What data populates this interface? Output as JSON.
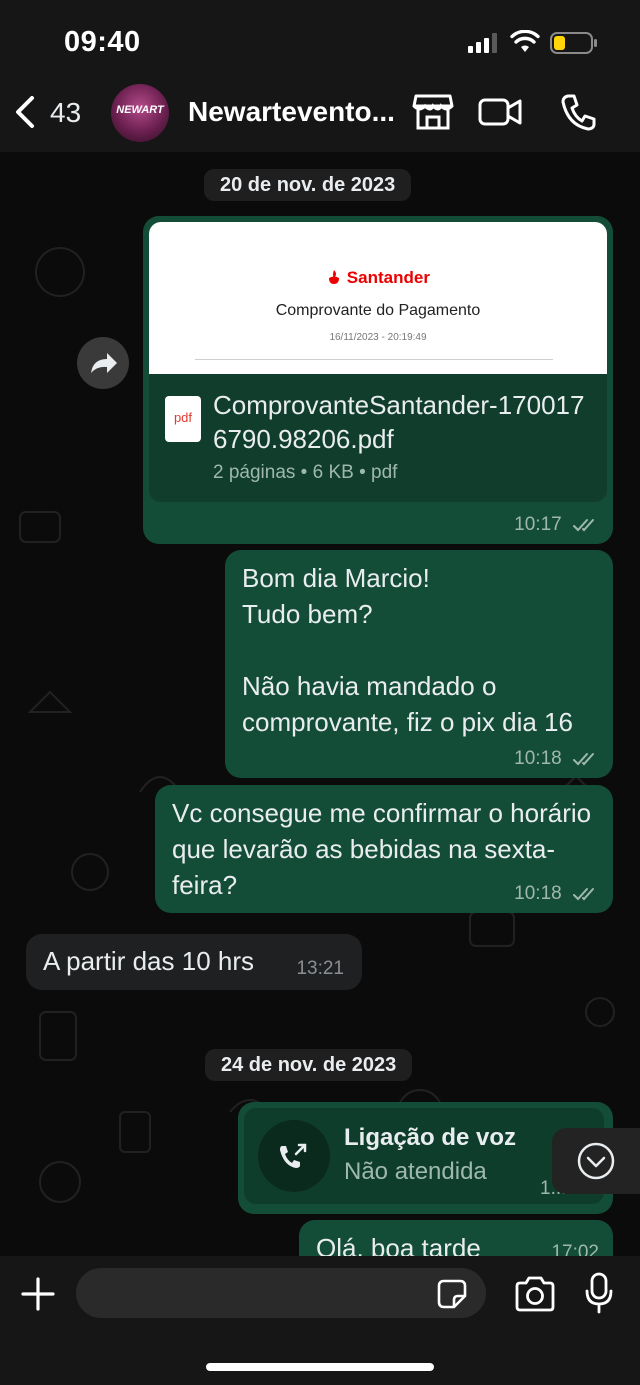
{
  "status_bar": {
    "time": "09:40"
  },
  "header": {
    "back_count": "43",
    "title": "Newartevento...",
    "avatar_text": "NEWART",
    "icons": [
      "back-chevron-icon",
      "store-icon",
      "video-call-icon",
      "phone-icon"
    ]
  },
  "dates": [
    "20 de nov. de 2023",
    "24 de nov. de 2023"
  ],
  "document": {
    "brand": "Santander",
    "preview_title": "Comprovante do Pagamento",
    "preview_date": "16/11/2023 - 20:19:49",
    "file_icon_label": "pdf",
    "file_name": "ComprovanteSantander-1700176790.98206.pdf",
    "file_info": "2 páginas • 6 KB • pdf",
    "time": "10:17"
  },
  "messages": [
    {
      "direction": "out",
      "text": "Bom dia Marcio!\nTudo bem?\n\nNão havia mandado o comprovante, fiz o pix dia 16",
      "time": "10:18"
    },
    {
      "direction": "out",
      "text": "Vc consegue me confirmar o horário que levarão as bebidas na sexta-feira?",
      "time": "10:18"
    },
    {
      "direction": "in",
      "text": "A partir das 10 hrs",
      "time": "13:21"
    }
  ],
  "call": {
    "title": "Ligação de voz",
    "subtitle": "Não atendida",
    "time": "1..."
  },
  "partial_message": {
    "text": "Olá, boa tarde",
    "time": "17:02"
  },
  "input": {
    "placeholder": ""
  },
  "colors": {
    "outgoing_bubble": "#144d37",
    "incoming_bubble": "#1f2021",
    "background": "#0b0b0b"
  }
}
